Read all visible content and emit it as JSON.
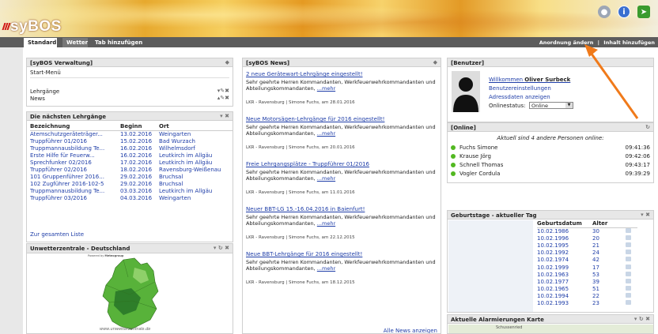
{
  "header": {
    "logo": "syBOS",
    "icons": [
      "people-icon",
      "info-icon",
      "logout-icon"
    ]
  },
  "tabs": {
    "items": [
      "Standard",
      "Wetter"
    ],
    "add_label": "Tab hinzufügen",
    "right_arrange": "Anordnung ändern",
    "right_sep": "|",
    "right_add": "Inhalt hinzufügen"
  },
  "verwaltung": {
    "title": "[syBOS Verwaltung]",
    "start": "Start-Menü",
    "lehrgaenge": "Lehrgänge",
    "news": "News"
  },
  "lehrgaenge": {
    "title": "Die nächsten Lehrgänge",
    "headers": [
      "Bezeichnung",
      "Beginn",
      "Ort"
    ],
    "rows": [
      [
        "Atemschutzgeräteträger...",
        "13.02.2016",
        "Weingarten"
      ],
      [
        "Truppführer 01/2016",
        "15.02.2016",
        "Bad Wurzach"
      ],
      [
        "Truppmannausbildung Te...",
        "16.02.2016",
        "Wilhelmsdorf"
      ],
      [
        "Erste Hilfe für Feuerw...",
        "16.02.2016",
        "Leutkirch im Allgäu"
      ],
      [
        "Sprechfunker 02/2016",
        "17.02.2016",
        "Leutkirch im Allgäu"
      ],
      [
        "Truppführer 02/2016",
        "18.02.2016",
        "Ravensburg-Weißenau"
      ],
      [
        "101 Gruppenführer 2016...",
        "29.02.2016",
        "Bruchsal"
      ],
      [
        "102 Zugführer 2016-102-5",
        "29.02.2016",
        "Bruchsal"
      ],
      [
        "Truppmannausbildung Te...",
        "03.03.2016",
        "Leutkirch im Allgäu"
      ],
      [
        "Truppführer 03/2016",
        "04.03.2016",
        "Weingarten"
      ]
    ],
    "all_link": "Zur gesamten Liste"
  },
  "unwetter": {
    "title": "Unwetterzentrale - Deutschland",
    "powered": "Powered by ",
    "powered_brand": "Meteogroup",
    "url": "www.unwetterzentrale.de"
  },
  "news": {
    "title": "[syBOS News]",
    "body": "Sehr geehrte Herren Kommandanten, Werkfeuerwehrkommandanten und Abteilungskommandanten, ",
    "more": "...mehr",
    "items": [
      {
        "headline": "2 neue Gerätewart-Lehrgänge eingestellt!",
        "meta": "LKR - Ravensburg | Simone Fuchs, am 28.01.2016"
      },
      {
        "headline": "Neue Motorsägen-Lehrgänge für 2016 eingestellt!",
        "meta": "LKR - Ravensburg | Simone Fuchs, am 20.01.2016"
      },
      {
        "headline": "Freie Lehrgangsplätze - Truppführer 01/2016",
        "meta": "LKR - Ravensburg | Simone Fuchs, am 11.01.2016"
      },
      {
        "headline": "Neuer BBT-LG 15.-16.04.2016 in Baienfurt!",
        "meta": "LKR - Ravensburg | Simone Fuchs, am 22.12.2015"
      },
      {
        "headline": "Neue BBT-Lehrgänge für 2016 eingestellt!",
        "meta": "LKR - Ravensburg | Simone Fuchs, am 18.12.2015"
      }
    ],
    "all": "Alle News anzeigen"
  },
  "benutzer": {
    "title": "[Benutzer]",
    "welcome": "Willkommen ",
    "name": "Oliver Surbeck",
    "settings": "Benutzereinstellungen",
    "address": "Adressdaten anzeigen",
    "status_label": "Onlinestatus: ",
    "status_value": "Online"
  },
  "online": {
    "title": "[Online]",
    "summary": "Aktuell sind 4 andere Personen online:",
    "users": [
      {
        "name": "Fuchs Simone",
        "time": "09:41:36"
      },
      {
        "name": "Krause Jörg",
        "time": "09:42:06"
      },
      {
        "name": "Schnell Thomas",
        "time": "09:43:17"
      },
      {
        "name": "Vogler Cordula",
        "time": "09:39:29"
      }
    ]
  },
  "geburtstage": {
    "title": "Geburtstage - aktueller Tag",
    "headers": [
      "Geburtsdatum",
      "Alter"
    ],
    "rows": [
      [
        "10.02.1986",
        "30"
      ],
      [
        "10.02.1996",
        "20"
      ],
      [
        "10.02.1995",
        "21"
      ],
      [
        "10.02.1992",
        "24"
      ],
      [
        "10.02.1974",
        "42"
      ],
      [
        "10.02.1999",
        "17"
      ],
      [
        "10.02.1963",
        "53"
      ],
      [
        "10.02.1977",
        "39"
      ],
      [
        "10.02.1965",
        "51"
      ],
      [
        "10.02.1994",
        "22"
      ],
      [
        "10.02.1993",
        "23"
      ]
    ]
  },
  "alarm": {
    "title": "Aktuelle Alarmierungen Karte",
    "place": "Schussenried"
  },
  "colors": {
    "accent_link": "#1f3ea8",
    "online_dot": "#52b821",
    "arrow": "#f07a1a"
  }
}
